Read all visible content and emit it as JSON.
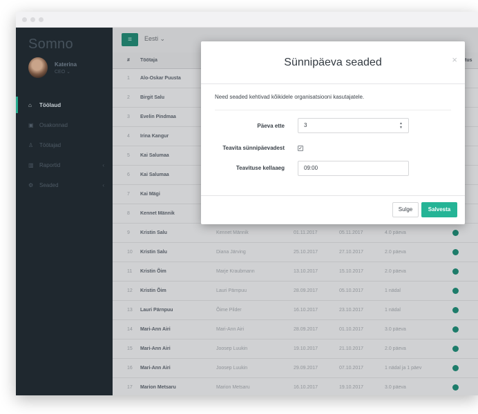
{
  "app": {
    "brand": "Somno",
    "user": {
      "name": "Katerina",
      "role": "CEO ⌄"
    }
  },
  "sidebar": {
    "items": [
      {
        "label": "Töölaud",
        "icon": "home-icon",
        "active": true
      },
      {
        "label": "Osakonnad",
        "icon": "briefcase-icon",
        "active": false
      },
      {
        "label": "Töötajad",
        "icon": "user-icon",
        "active": false
      },
      {
        "label": "Raportid",
        "icon": "chart-icon",
        "active": false,
        "chevron": "‹"
      },
      {
        "label": "Seaded",
        "icon": "settings-icon",
        "active": false,
        "chevron": "‹"
      }
    ]
  },
  "toolbar": {
    "add_icon": "≡",
    "export_label": "Eesti ⌄"
  },
  "table": {
    "headers": {
      "num": "#",
      "name": "Töötaja",
      "tail": "tus"
    },
    "rows": [
      {
        "num": "1",
        "name": "Alo-Oskar Puusta",
        "rep": "",
        "d1": "",
        "d2": "",
        "dur": ""
      },
      {
        "num": "2",
        "name": "Birgit Salu",
        "rep": "",
        "d1": "",
        "d2": "",
        "dur": ""
      },
      {
        "num": "3",
        "name": "Evelin Pindmaa",
        "rep": "",
        "d1": "",
        "d2": "",
        "dur": ""
      },
      {
        "num": "4",
        "name": "Irina Kangur",
        "rep": "",
        "d1": "",
        "d2": "",
        "dur": ""
      },
      {
        "num": "5",
        "name": "Kai Salumaa",
        "rep": "",
        "d1": "",
        "d2": "",
        "dur": ""
      },
      {
        "num": "6",
        "name": "Kai Salumaa",
        "rep": "",
        "d1": "",
        "d2": "",
        "dur": ""
      },
      {
        "num": "7",
        "name": "Kai Mägi",
        "rep": "",
        "d1": "",
        "d2": "",
        "dur": ""
      },
      {
        "num": "8",
        "name": "Kennet Männik",
        "rep": "",
        "d1": "",
        "d2": "",
        "dur": ""
      },
      {
        "num": "9",
        "name": "Kristin Salu",
        "rep": "Kennet Männik",
        "d1": "01.11.2017",
        "d2": "05.11.2017",
        "dur": "4.0 päeva"
      },
      {
        "num": "10",
        "name": "Kristin Salu",
        "rep": "Diana Järving",
        "d1": "25.10.2017",
        "d2": "27.10.2017",
        "dur": "2.0 päeva"
      },
      {
        "num": "11",
        "name": "Kristin Õim",
        "rep": "Marje Kraubmann",
        "d1": "13.10.2017",
        "d2": "15.10.2017",
        "dur": "2.0 päeva"
      },
      {
        "num": "12",
        "name": "Kristin Õim",
        "rep": "Lauri Pärnpuu",
        "d1": "28.09.2017",
        "d2": "05.10.2017",
        "dur": "1 nädal"
      },
      {
        "num": "13",
        "name": "Lauri Pärnpuu",
        "rep": "Õime Pilder",
        "d1": "16.10.2017",
        "d2": "23.10.2017",
        "dur": "1 nädal"
      },
      {
        "num": "14",
        "name": "Mari-Ann Airi",
        "rep": "Mari-Ann Airi",
        "d1": "28.09.2017",
        "d2": "01.10.2017",
        "dur": "3.0 päeva"
      },
      {
        "num": "15",
        "name": "Mari-Ann Airi",
        "rep": "Joosep Luukin",
        "d1": "19.10.2017",
        "d2": "21.10.2017",
        "dur": "2.0 päeva"
      },
      {
        "num": "16",
        "name": "Mari-Ann Airi",
        "rep": "Joosep Luukin",
        "d1": "29.09.2017",
        "d2": "07.10.2017",
        "dur": "1 nädal ja 1 päev"
      },
      {
        "num": "17",
        "name": "Marion Metsaru",
        "rep": "Marion Metsaru",
        "d1": "16.10.2017",
        "d2": "19.10.2017",
        "dur": "3.0 päeva"
      }
    ]
  },
  "modal": {
    "title": "Sünnipäeva seaded",
    "close_glyph": "×",
    "description": "Need seaded kehtivad kõikidele organisatsiooni kasutajatele.",
    "fields": {
      "days_before": {
        "label": "Päeva ette",
        "value": "3"
      },
      "notify": {
        "label": "Teavita sünnipäevadest",
        "checked": true,
        "mark": "✓"
      },
      "time": {
        "label": "Teavituse kellaaeg",
        "value": "09:00"
      }
    },
    "buttons": {
      "close": "Sulge",
      "save": "Salvesta"
    }
  },
  "colors": {
    "accent": "#25b496",
    "sidebar": "#1f282f",
    "status": "#1d8f78"
  }
}
